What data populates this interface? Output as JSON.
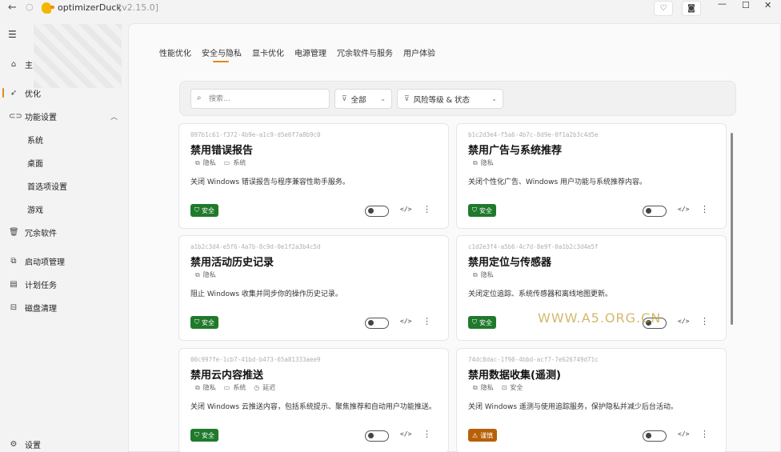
{
  "titlebar": {
    "app_name": "optimizerDuck",
    "version": "[v2.15.0]",
    "icons": [
      "back-arrow",
      "refresh",
      "app-logo",
      "heart",
      "camera",
      "minimize",
      "maximize",
      "close"
    ]
  },
  "sidebar": {
    "home_label": "主",
    "items": [
      {
        "label": "优化",
        "icon": "rocket"
      },
      {
        "label": "功能设置",
        "icon": "toggle"
      },
      {
        "label": "系统"
      },
      {
        "label": "桌面"
      },
      {
        "label": "首选项设置"
      },
      {
        "label": "游戏"
      },
      {
        "label": "冗余软件",
        "icon": "trash"
      },
      {
        "label": "启动项管理",
        "icon": "startup"
      },
      {
        "label": "计划任务",
        "icon": "calendar"
      },
      {
        "label": "磁盘清理",
        "icon": "disk"
      }
    ],
    "settings_label": "设置"
  },
  "tabs": [
    "性能优化",
    "安全与隐私",
    "显卡优化",
    "电源管理",
    "冗余软件与服务",
    "用户体验"
  ],
  "active_tab": "安全与隐私",
  "filters": {
    "search_placeholder": "搜索...",
    "category": "全部",
    "risk_label": "风险等级 & 状态"
  },
  "cards": [
    {
      "id": "097b1c61-f372-4b9e-a1c9-d5e6f7a8b9c0",
      "title": "禁用错误报告",
      "tags": [
        "隐私",
        "系统"
      ],
      "desc": "关闭 Windows 错误报告与程序兼容性助手服务。",
      "risk": "安全",
      "risk_type": "safe"
    },
    {
      "id": "b1c2d3e4-f5a6-4b7c-8d9e-0f1a2b3c4d5e",
      "title": "禁用广告与系统推荐",
      "tags": [
        "隐私"
      ],
      "desc": "关闭个性化广告、Windows 用户功能与系统推荐内容。",
      "risk": "安全",
      "risk_type": "safe"
    },
    {
      "id": "a1b2c3d4-e5f6-4a7b-8c9d-0e1f2a3b4c5d",
      "title": "禁用活动历史记录",
      "tags": [
        "隐私"
      ],
      "desc": "阻止 Windows 收集并同步你的操作历史记录。",
      "risk": "安全",
      "risk_type": "safe"
    },
    {
      "id": "c1d2e3f4-a5b6-4c7d-8e9f-0a1b2c3d4e5f",
      "title": "禁用定位与传感器",
      "tags": [
        "隐私"
      ],
      "desc": "关闭定位追踪、系统传感器和离线地图更新。",
      "risk": "安全",
      "risk_type": "safe"
    },
    {
      "id": "00c997fe-1cb7-41bd-b473-65a81333aee9",
      "title": "禁用云内容推送",
      "tags": [
        "隐私",
        "系统",
        "延迟"
      ],
      "desc": "关闭 Windows 云推送内容，包括系统提示、聚焦推荐和自动用户功能推送。",
      "risk": "安全",
      "risk_type": "safe"
    },
    {
      "id": "74dc8dac-1f90-4bbd-acf7-7e626749d71c",
      "title": "禁用数据收集(遥测)",
      "tags": [
        "隐私",
        "安全"
      ],
      "desc": "关闭 Windows 遥测与使用追踪服务，保护隐私并减少后台活动。",
      "risk": "谨慎",
      "risk_type": "caution"
    }
  ],
  "watermark": "WWW.A5.ORG.CN",
  "colors": {
    "accent": "#e0891b",
    "safe": "#1f7a2b",
    "caution": "#b86007"
  }
}
